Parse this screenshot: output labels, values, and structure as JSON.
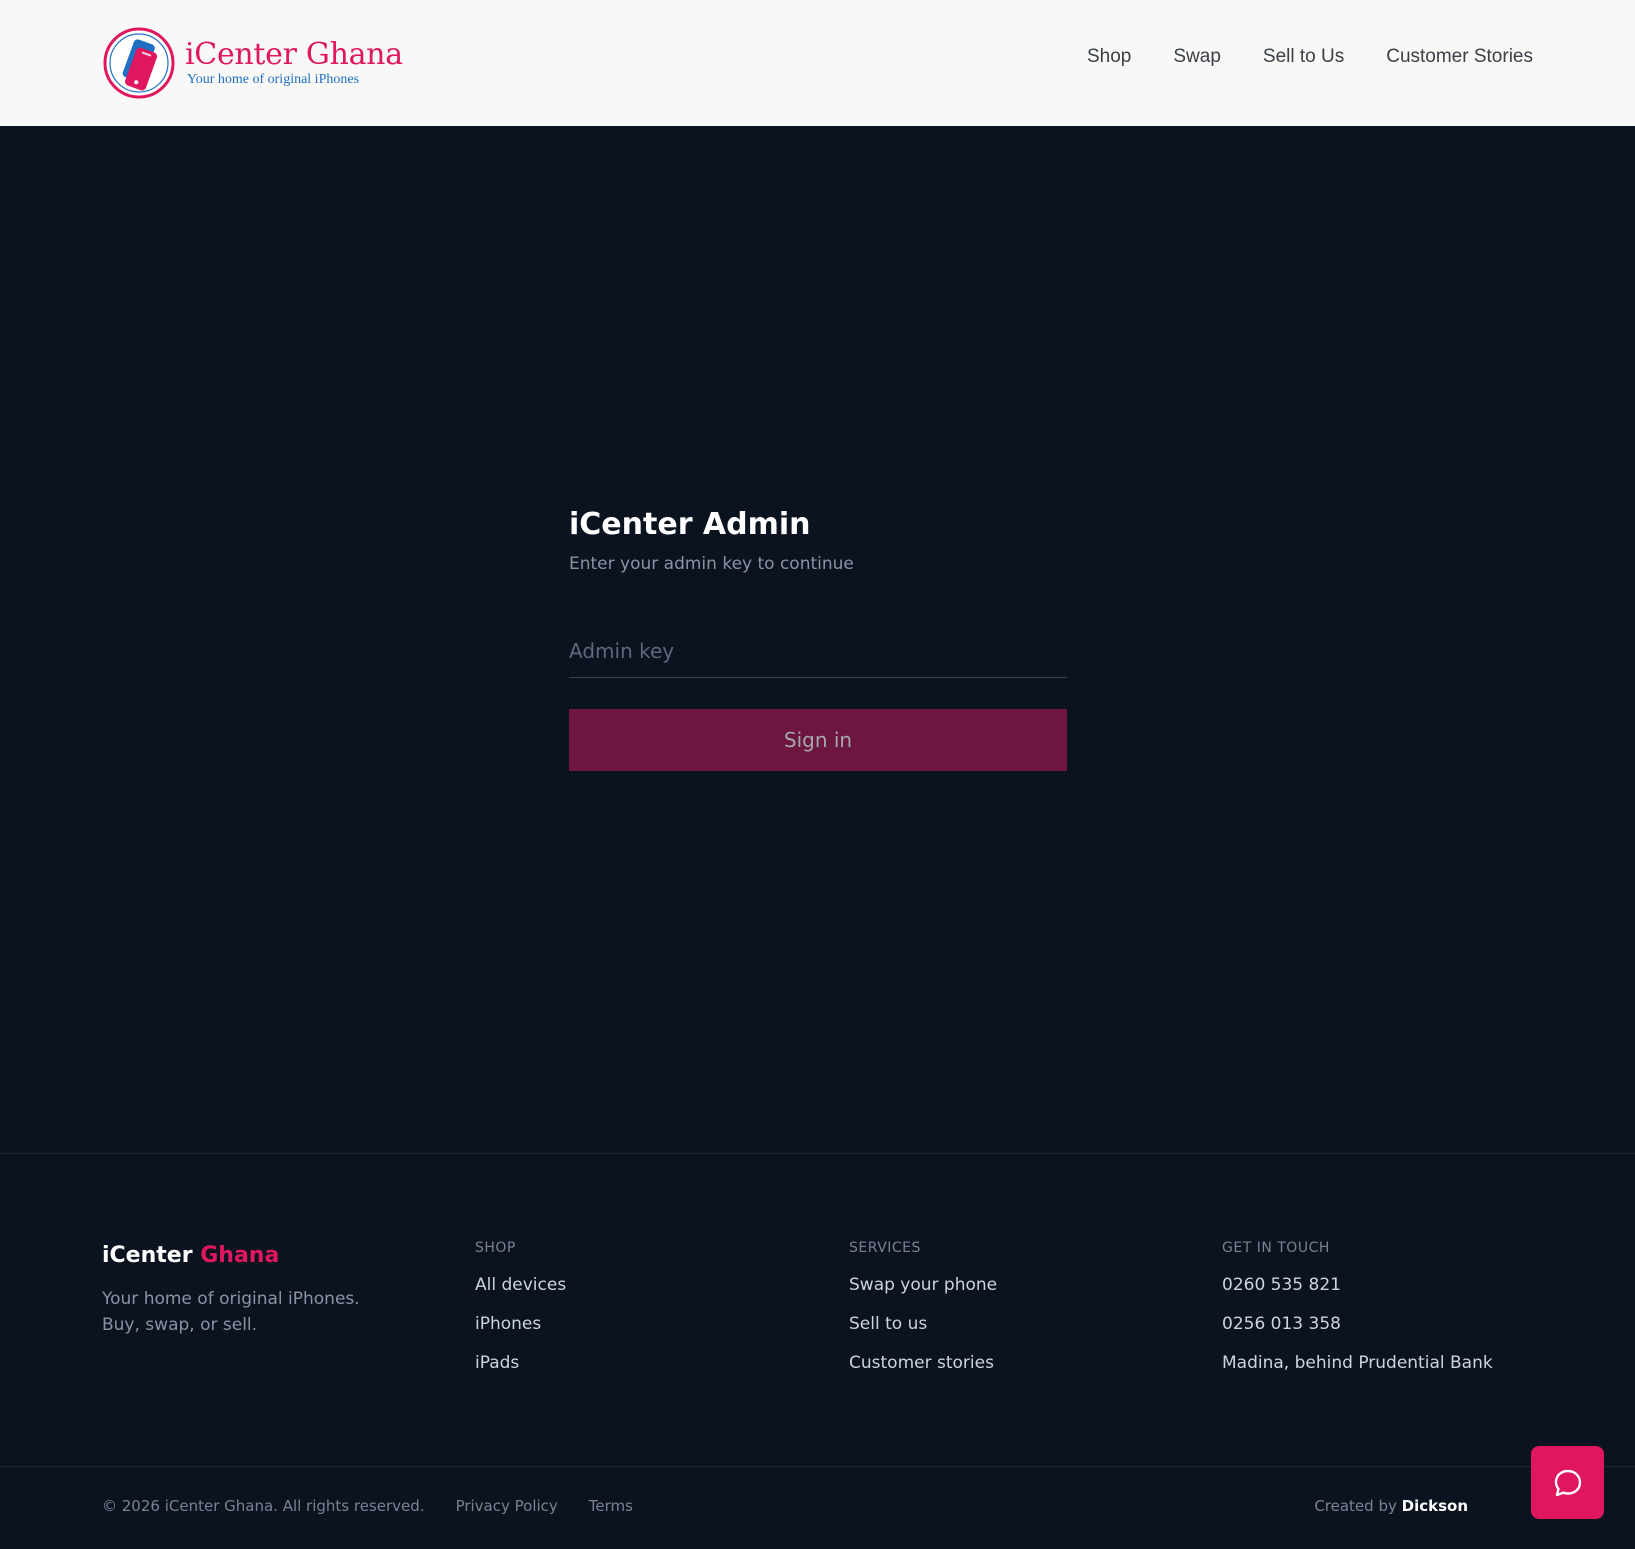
{
  "header": {
    "logo_title": "iCenter Ghana",
    "logo_tagline": "Your home of original iPhones",
    "nav": [
      "Shop",
      "Swap",
      "Sell to Us",
      "Customer Stories"
    ]
  },
  "login": {
    "title": "iCenter Admin",
    "subtitle": "Enter your admin key to continue",
    "input_placeholder": "Admin key",
    "input_value": "",
    "button_label": "Sign in"
  },
  "footer": {
    "brand_part1": "iCenter",
    "brand_part2": "Ghana",
    "brand_desc": "Your home of original iPhones. Buy, swap, or sell.",
    "shop": {
      "heading": "SHOP",
      "items": [
        "All devices",
        "iPhones",
        "iPads"
      ]
    },
    "services": {
      "heading": "SERVICES",
      "items": [
        "Swap your phone",
        "Sell to us",
        "Customer stories"
      ]
    },
    "contact": {
      "heading": "GET IN TOUCH",
      "items": [
        "0260 535 821",
        "0256 013 358",
        "Madina, behind Prudential Bank"
      ]
    },
    "copyright": "© 2026 iCenter Ghana. All rights reserved.",
    "privacy": "Privacy Policy",
    "terms": "Terms",
    "created_by": "Created by",
    "creator": "Dickson"
  },
  "icons": {
    "logo": "phone-logo-icon",
    "chat": "chat-bubble-icon"
  },
  "colors": {
    "accent": "#e0175e",
    "background": "#0c1320",
    "header_bg": "#f8f8f6",
    "button_bg": "#6d1640",
    "tagline": "#1f6fc5"
  }
}
